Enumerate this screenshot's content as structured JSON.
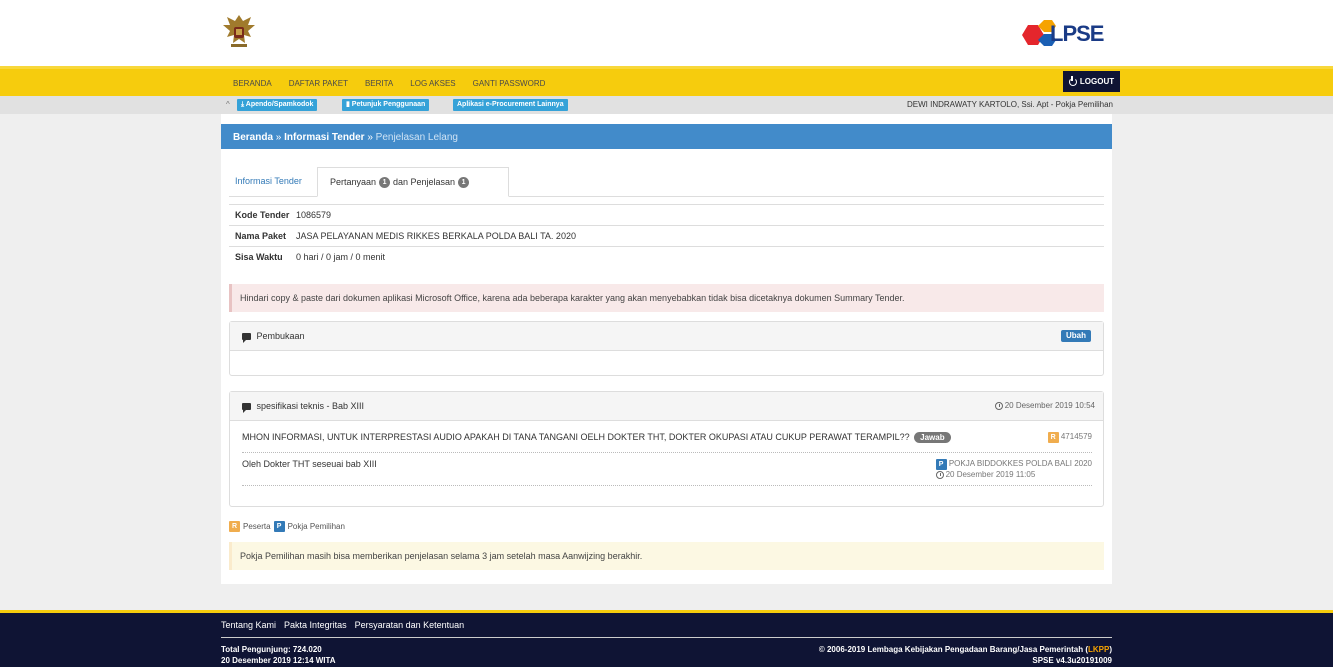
{
  "header": {
    "logo_text": "LPSE"
  },
  "nav": {
    "items": [
      "BERANDA",
      "DAFTAR PAKET",
      "BERITA",
      "LOG AKSES",
      "GANTI PASSWORD"
    ],
    "logout": "LOGOUT"
  },
  "subbar": {
    "buttons": [
      "Apendo/Spamkodok",
      "Petunjuk Penggunaan",
      "Aplikasi e-Procurement Lainnya"
    ],
    "user": "DEWI INDRAWATY KARTOLO, Ssi. Apt - Pokja Pemilihan"
  },
  "breadcrumb": {
    "home": "Beranda",
    "sep": "»",
    "level1": "Informasi Tender",
    "current": "Penjelasan Lelang"
  },
  "tabs": {
    "info": "Informasi Tender",
    "qa_prefix": "Pertanyaan",
    "qa_count": "1",
    "qa_middle": "dan Penjelasan",
    "qa_count2": "1"
  },
  "tender": {
    "rows": [
      {
        "label": "Kode Tender",
        "value": "1086579"
      },
      {
        "label": "Nama Paket",
        "value": "JASA PELAYANAN MEDIS RIKKES BERKALA POLDA BALI TA. 2020"
      },
      {
        "label": "Sisa Waktu",
        "value": "0 hari / 0 jam / 0 menit"
      }
    ]
  },
  "warning": "Hindari copy & paste dari dokumen aplikasi Microsoft Office, karena ada beberapa karakter yang akan menyebabkan tidak bisa dicetaknya dokumen Summary Tender.",
  "pembukaan": {
    "title": "Pembukaan",
    "edit": "Ubah"
  },
  "thread": {
    "title": "spesifikasi teknis - Bab XIII",
    "date": "20 Desember 2019 10:54",
    "question": "MHON INFORMASI, UNTUK INTERPRESTASI AUDIO APAKAH DI TANA TANGANI OELH DOKTER THT, DOKTER OKUPASI ATAU CUKUP PERAWAT TERAMPIL??",
    "answer_button": "Jawab",
    "participant_tag": "R",
    "participant_id": "4714579",
    "answer": "Oleh Dokter THT seseuai bab XIII",
    "answer_tag": "P",
    "answer_by": "POKJA BIDDOKKES POLDA BALI 2020",
    "answer_date": "20 Desember 2019 11:05"
  },
  "legend": {
    "r_tag": "R",
    "r_label": "Peserta",
    "p_tag": "P",
    "p_label": "Pokja Pemilihan"
  },
  "notice": "Pokja Pemilihan masih bisa memberikan penjelasan selama 3 jam setelah masa Aanwijzing berakhir.",
  "footer": {
    "links": [
      "Tentang Kami",
      "Pakta Integritas",
      "Persyaratan dan Ketentuan"
    ],
    "visitors": "Total Pengunjung: 724.020",
    "datetime": "20 Desember 2019 12:14 WITA",
    "copyright_pre": "© 2006-2019 Lembaga Kebijakan Pengadaan Barang/Jasa Pemerintah (",
    "copyright_link": "LKPP",
    "copyright_post": ")",
    "version": "SPSE v4.3u20191009"
  },
  "colors": {
    "nav_yellow": "#f6cc0d",
    "footer_navy": "#0f1434",
    "primary_blue": "#428bca",
    "info_blue": "#35a2d8"
  }
}
